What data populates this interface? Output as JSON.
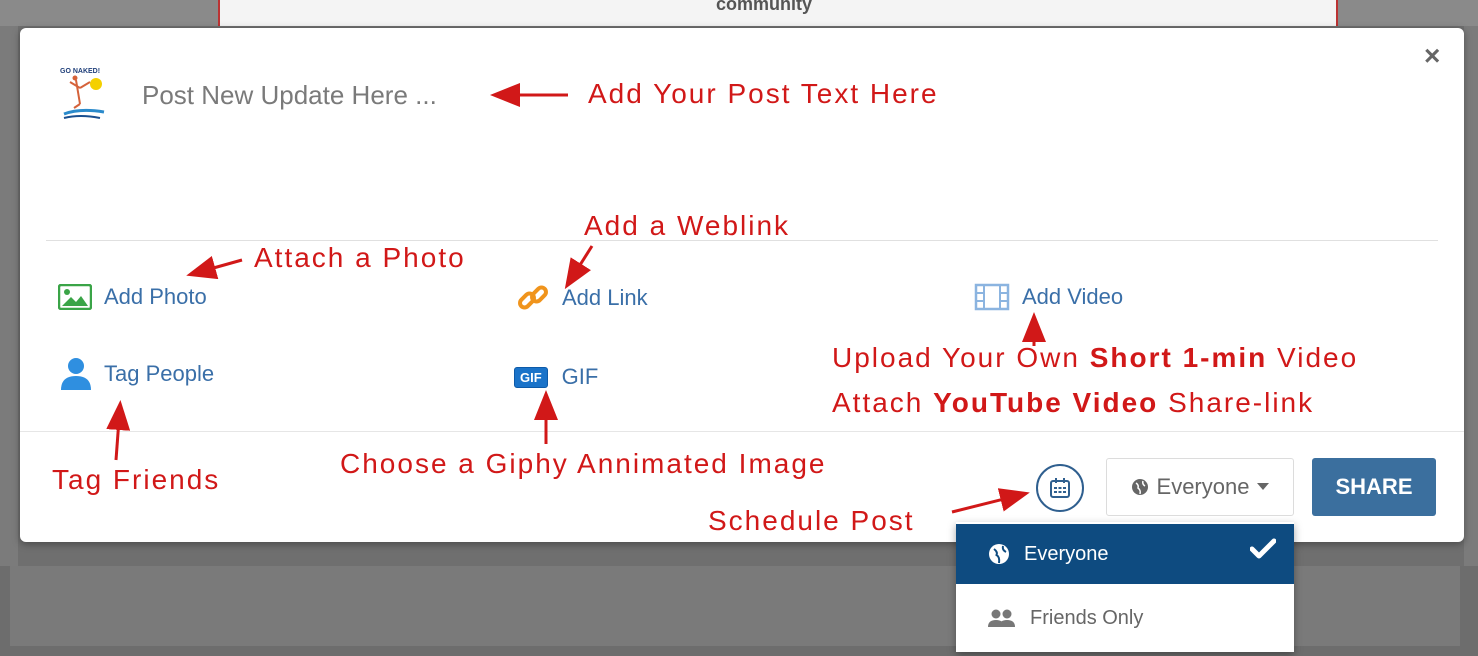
{
  "background": {
    "header_text": "community"
  },
  "composer": {
    "placeholder": "Post New Update Here ...",
    "avatar_text": "GO NAKED!",
    "close_glyph": "×",
    "actions": {
      "add_photo": "Add Photo",
      "add_link": "Add Link",
      "add_video": "Add Video",
      "tag_people": "Tag People",
      "gif_badge": "GIF",
      "gif": "GIF"
    },
    "privacy": {
      "selected": "Everyone"
    },
    "share_label": "SHARE",
    "dropdown": {
      "items": [
        "Everyone",
        "Friends Only"
      ]
    }
  },
  "annotations": {
    "post_text": "Add Your Post Text Here",
    "attach_photo": "Attach a Photo",
    "add_weblink": "Add a Weblink",
    "video_line1_a": "Upload Your Own ",
    "video_line1_b": "Short 1-min",
    "video_line1_c": " Video",
    "video_line2_a": "Attach ",
    "video_line2_b": "YouTube Video",
    "video_line2_c": " Share-link",
    "tag_friends": "Tag Friends",
    "giphy": "Choose a Giphy Annimated Image",
    "schedule": "Schedule Post"
  },
  "colors": {
    "annotation": "#d11818",
    "link": "#3a6fa8",
    "primary": "#3b6f9e",
    "dropdown_active": "#0e4b80"
  }
}
